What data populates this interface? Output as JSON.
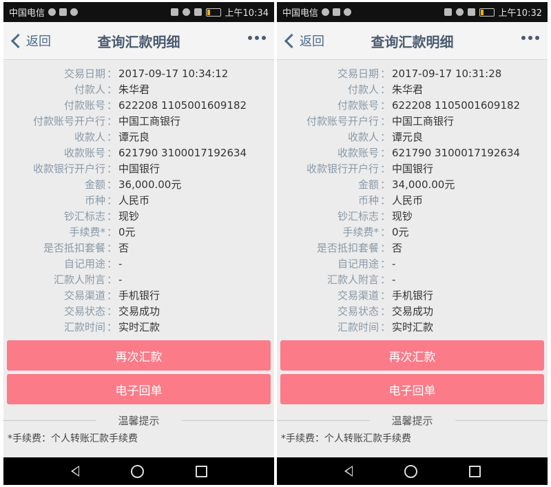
{
  "screens": [
    {
      "status": {
        "carrier": "中国电信",
        "time": "上午10:34"
      },
      "nav": {
        "back_label": "返回",
        "title": "查询汇款明细"
      },
      "rows": [
        {
          "label": "交易日期",
          "value": "2017-09-17 10:34:12"
        },
        {
          "label": "付款人",
          "value": "朱华君"
        },
        {
          "label": "付款账号",
          "value": "622208 1105001609182"
        },
        {
          "label": "付款账号开户行",
          "value": "中国工商银行"
        },
        {
          "label": "收款人",
          "value": "谭元良"
        },
        {
          "label": "收款账号",
          "value": "621790 3100017192634"
        },
        {
          "label": "收款银行开户行",
          "value": "中国银行"
        },
        {
          "label": "金额",
          "value": "36,000.00元"
        },
        {
          "label": "币种",
          "value": "人民币"
        },
        {
          "label": "钞汇标志",
          "value": "现钞"
        },
        {
          "label": "手续费*",
          "value": "0元"
        },
        {
          "label": "是否抵扣套餐",
          "value": "否"
        },
        {
          "label": "自记用途",
          "value": "-"
        },
        {
          "label": "汇款人附言",
          "value": "-"
        },
        {
          "label": "交易渠道",
          "value": "手机银行"
        },
        {
          "label": "交易状态",
          "value": "交易成功"
        },
        {
          "label": "汇款时间",
          "value": "实时汇款"
        }
      ],
      "buttons": {
        "again": "再次汇款",
        "receipt": "电子回单"
      },
      "tips": {
        "title": "温馨提示",
        "note": "*手续费：个人转账汇款手续费"
      }
    },
    {
      "status": {
        "carrier": "中国电信",
        "time": "上午10:32"
      },
      "nav": {
        "back_label": "返回",
        "title": "查询汇款明细"
      },
      "rows": [
        {
          "label": "交易日期",
          "value": "2017-09-17 10:31:28"
        },
        {
          "label": "付款人",
          "value": "朱华君"
        },
        {
          "label": "付款账号",
          "value": "622208 1105001609182"
        },
        {
          "label": "付款账号开户行",
          "value": "中国工商银行"
        },
        {
          "label": "收款人",
          "value": "谭元良"
        },
        {
          "label": "收款账号",
          "value": "621790 3100017192634"
        },
        {
          "label": "收款银行开户行",
          "value": "中国银行"
        },
        {
          "label": "金额",
          "value": "34,000.00元"
        },
        {
          "label": "币种",
          "value": "人民币"
        },
        {
          "label": "钞汇标志",
          "value": "现钞"
        },
        {
          "label": "手续费*",
          "value": "0元"
        },
        {
          "label": "是否抵扣套餐",
          "value": "否"
        },
        {
          "label": "自记用途",
          "value": "-"
        },
        {
          "label": "汇款人附言",
          "value": "-"
        },
        {
          "label": "交易渠道",
          "value": "手机银行"
        },
        {
          "label": "交易状态",
          "value": "交易成功"
        },
        {
          "label": "汇款时间",
          "value": "实时汇款"
        }
      ],
      "buttons": {
        "again": "再次汇款",
        "receipt": "电子回单"
      },
      "tips": {
        "title": "温馨提示",
        "note": "*手续费：个人转账汇款手续费"
      }
    }
  ],
  "separator": "：",
  "icons": [
    "wechat-icon",
    "notification-icon",
    "cloud-icon",
    "mute-icon",
    "wifi-icon",
    "signal-icon",
    "battery-icon",
    "back-chevron-icon",
    "more-icon",
    "nav-back-icon",
    "nav-home-icon",
    "nav-recent-icon"
  ],
  "colors": {
    "button": "#fb7b88",
    "label": "#8a99a8",
    "title": "#4a5b70"
  }
}
